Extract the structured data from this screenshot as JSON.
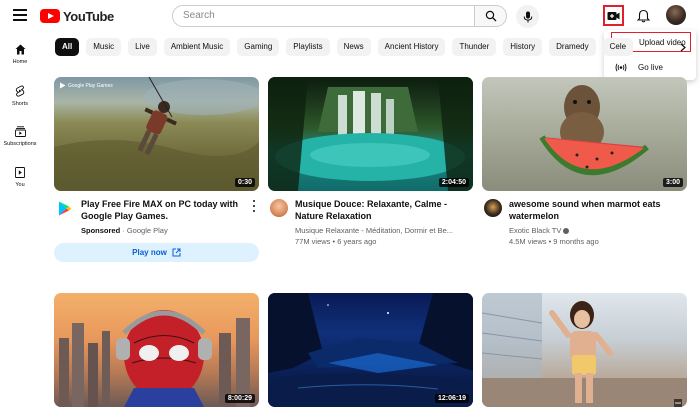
{
  "header": {
    "logo_text": "YouTube",
    "search_placeholder": "Search"
  },
  "create_menu": {
    "upload_label": "Upload video",
    "live_label": "Go live"
  },
  "sidebar": {
    "items": [
      {
        "label": "Home",
        "icon": "home-icon"
      },
      {
        "label": "Shorts",
        "icon": "shorts-icon"
      },
      {
        "label": "Subscriptions",
        "icon": "subscriptions-icon"
      },
      {
        "label": "You",
        "icon": "you-icon"
      }
    ]
  },
  "chips": [
    "All",
    "Music",
    "Live",
    "Ambient Music",
    "Gaming",
    "Playlists",
    "News",
    "Ancient History",
    "Thunder",
    "History",
    "Dramedy",
    "Cele"
  ],
  "videos": [
    {
      "title_line1": "Play Free Fire MAX on PC today with",
      "title_line2": "Google Play Games.",
      "sponsored": "Sponsored",
      "channel": "· Google Play",
      "duration": "0:30",
      "cta": "Play now",
      "thumb_caption": "Google Play Games"
    },
    {
      "title_line1": "Musique Douce: Relaxante, Calme -",
      "title_line2": "Nature Relaxation",
      "channel": "Musique Relaxante - Méditation, Dormir et Be...",
      "meta": "77M views • 6 years ago",
      "duration": "2:04:50"
    },
    {
      "title_line1": "awesome sound when marmot eats",
      "title_line2": "watermelon",
      "channel": "Exotic Black TV",
      "meta": "4.5M views • 9 months ago",
      "duration": "3:00"
    },
    {
      "duration": "8:00:29"
    },
    {
      "duration": "12:06:19"
    },
    {
      "duration": ""
    }
  ],
  "colors": {
    "brand_red": "#ff0000",
    "highlight_red": "#e0202a",
    "link_blue": "#065fd4"
  }
}
